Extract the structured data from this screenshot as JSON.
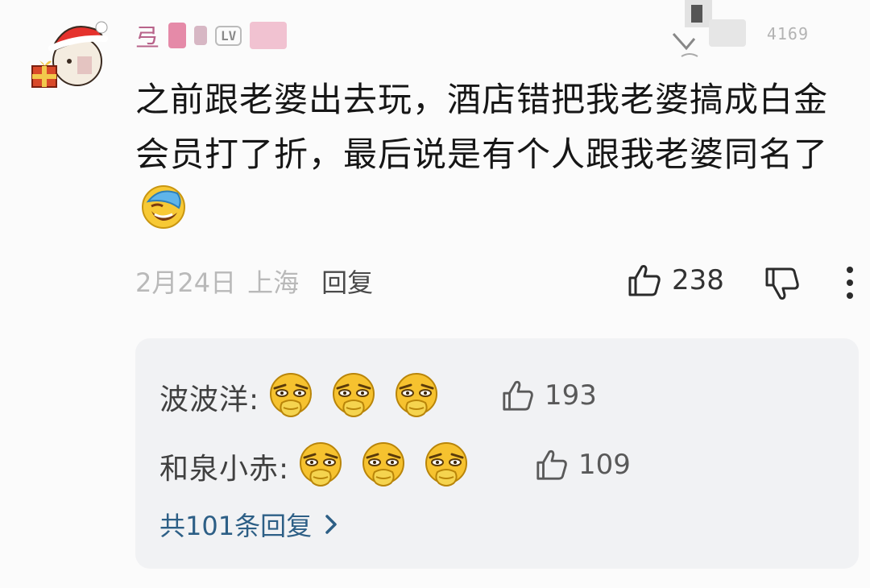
{
  "comment": {
    "username": "弖",
    "level_badge": "LV",
    "user_id": "4169",
    "text": "之前跟老婆出去玩，酒店错把我老婆搞成白金会员打了折，最后说是有个人跟我老婆同名了",
    "date": "2月24日",
    "location": "上海",
    "reply_label": "回复",
    "like_count": "238"
  },
  "replies": [
    {
      "author": "波波洋:",
      "emoji_count": 3,
      "like_count": "193"
    },
    {
      "author": "和泉小赤:",
      "emoji_count": 3,
      "like_count": "109"
    }
  ],
  "more_replies_label": "共101条回复",
  "icons": {
    "avatar": "santa-hat-avatar",
    "inline_emoji": "facepalm-laugh-emoji",
    "reply_emoji": "squinting-duck-face-emoji",
    "like": "thumbs-up-icon",
    "dislike": "thumbs-down-icon",
    "more": "vertical-ellipsis-icon",
    "chevron": "chevron-right-icon"
  },
  "colors": {
    "username": "#c87596",
    "link": "#2d5f86",
    "meta": "#b9b9b9",
    "panel_bg": "#f1f2f4"
  }
}
